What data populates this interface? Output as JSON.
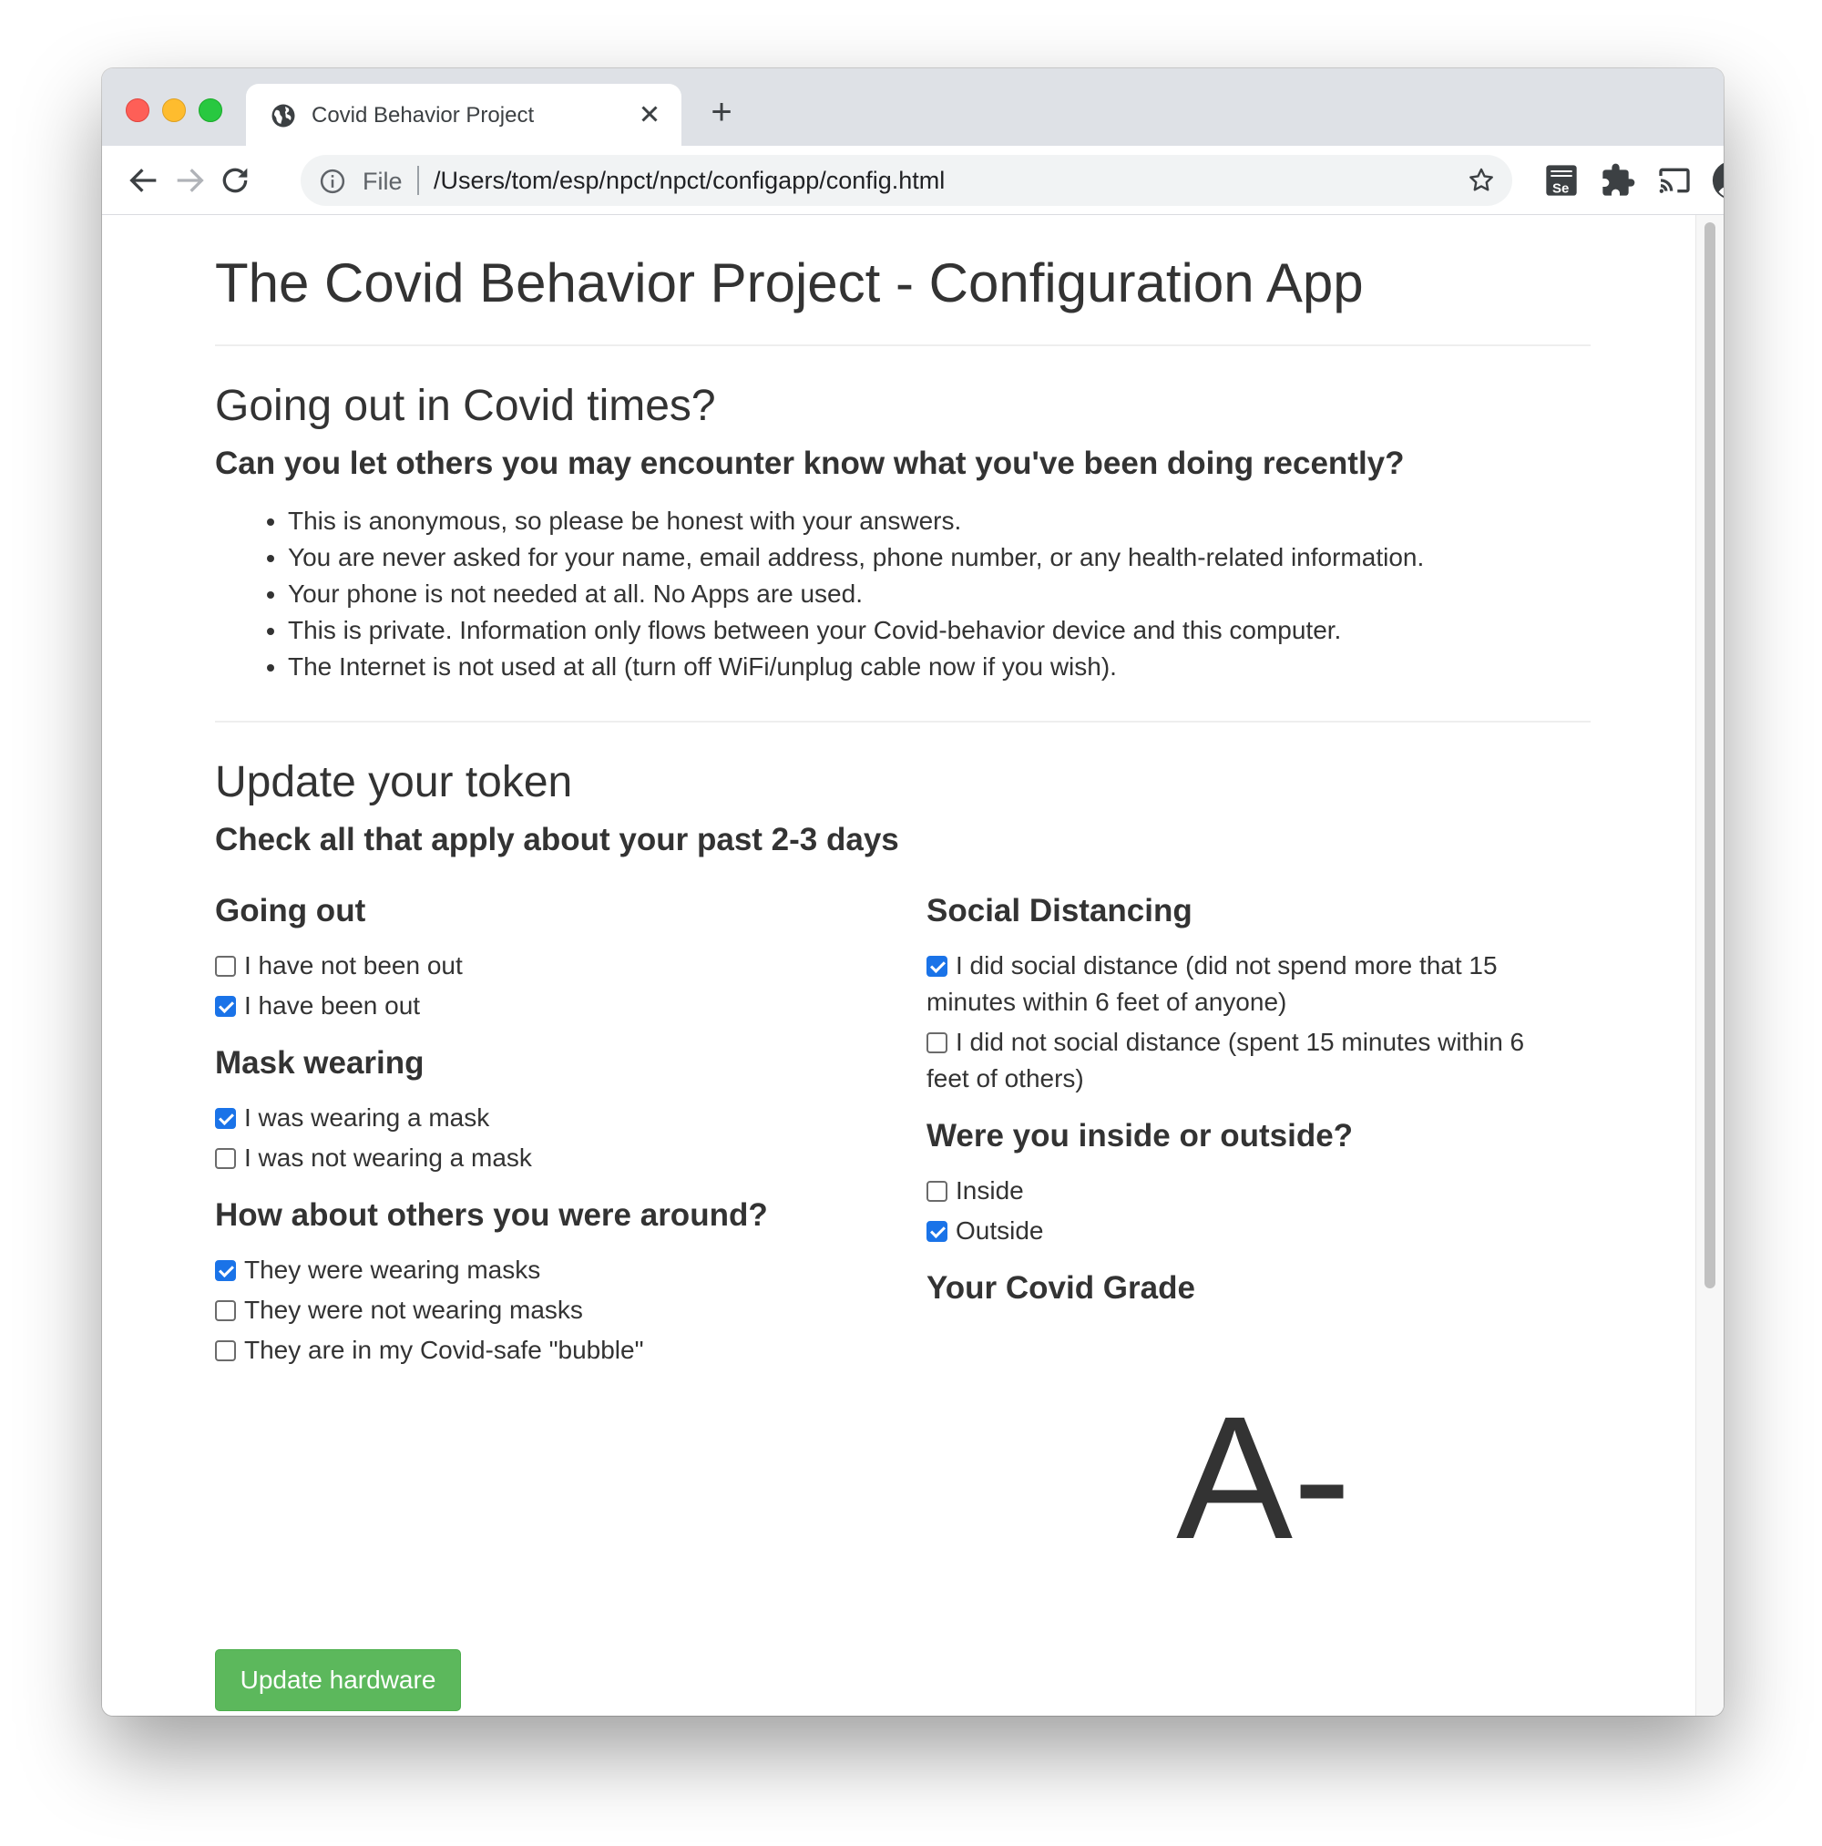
{
  "browser": {
    "tab_title": "Covid Behavior Project",
    "new_tab_label": "+",
    "address_scheme": "File",
    "address_url": "/Users/tom/esp/npct/npct/configapp/config.html"
  },
  "page": {
    "title": "The Covid Behavior Project - Configuration App",
    "intro": {
      "heading": "Going out in Covid times?",
      "subheading": "Can you let others you may encounter know what you've been doing recently?",
      "bullets": [
        "This is anonymous, so please be honest with your answers.",
        "You are never asked for your name, email address, phone number, or any health-related information.",
        "Your phone is not needed at all. No Apps are used.",
        "This is private. Information only flows between your Covid-behavior device and this computer.",
        "The Internet is not used at all (turn off WiFi/unplug cable now if you wish)."
      ]
    },
    "token": {
      "heading": "Update your token",
      "subheading": "Check all that apply about your past 2-3 days",
      "going_out": {
        "title": "Going out",
        "options": [
          {
            "label": "I have not been out",
            "checked": false
          },
          {
            "label": "I have been out",
            "checked": true
          }
        ]
      },
      "mask": {
        "title": "Mask wearing",
        "options": [
          {
            "label": "I was wearing a mask",
            "checked": true
          },
          {
            "label": "I was not wearing a mask",
            "checked": false
          }
        ]
      },
      "others": {
        "title": "How about others you were around?",
        "options": [
          {
            "label": "They were wearing masks",
            "checked": true
          },
          {
            "label": "They were not wearing masks",
            "checked": false
          },
          {
            "label": "They are in my Covid-safe \"bubble\"",
            "checked": false
          }
        ]
      },
      "distancing": {
        "title": "Social Distancing",
        "options": [
          {
            "label_line1": "I did social distance (did not spend more that 15",
            "label_line2": "minutes within 6 feet of anyone)",
            "checked": true
          },
          {
            "label_line1": "I did not social distance (spent 15 minutes within 6",
            "label_line2": "feet of others)",
            "checked": false
          }
        ]
      },
      "location": {
        "title": "Were you inside or outside?",
        "options": [
          {
            "label": "Inside",
            "checked": false
          },
          {
            "label": "Outside",
            "checked": true
          }
        ]
      },
      "grade": {
        "title": "Your Covid Grade",
        "value": "A-"
      },
      "update_button": "Update hardware"
    }
  },
  "colors": {
    "checkbox_checked": "#1a73e8",
    "button_success": "#5cb85c",
    "text": "#333333"
  },
  "icons": {
    "tab_favicon": "globe-icon",
    "tab_close": "close-icon",
    "back": "back-arrow-icon",
    "forward": "forward-arrow-icon",
    "reload": "reload-icon",
    "info": "info-icon",
    "bookmark": "star-icon",
    "selenium": "selenium-extension-icon",
    "extensions": "puzzle-icon",
    "cast": "cast-icon",
    "profile": "profile-icon",
    "menu": "kebab-menu-icon"
  }
}
